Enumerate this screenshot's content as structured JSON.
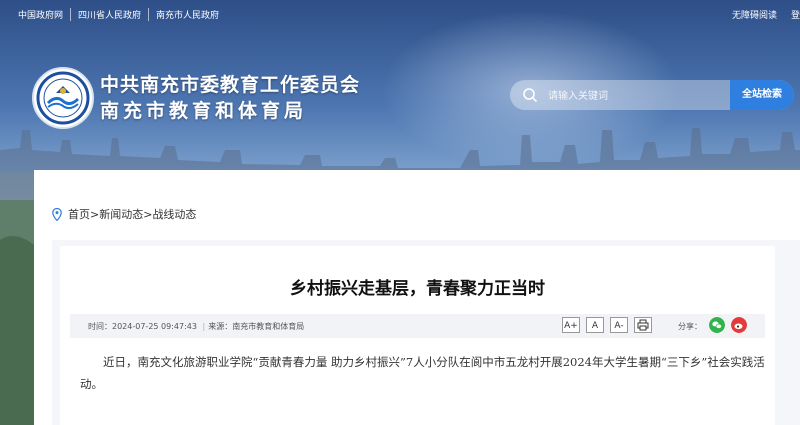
{
  "topbar": {
    "links": [
      "中国政府网",
      "四川省人民政府",
      "南充市人民政府"
    ],
    "accessibility": "无障碍阅读",
    "login": "登"
  },
  "header": {
    "title_line1": "中共南充市委教育工作委员会",
    "title_line2": "南充市教育和体育局"
  },
  "search": {
    "placeholder": "请输入关键词",
    "button_label": "全站检索"
  },
  "breadcrumb": {
    "home": "首页",
    "sep1": ">",
    "section": "新闻动态",
    "sep2": ">",
    "current": "战线动态"
  },
  "article": {
    "title": "乡村振兴走基层，青春聚力正当时",
    "time_label": "时间：",
    "time": "2024-07-25 09:47:43",
    "source_label": "来源：",
    "source": "南充市教育和体育局",
    "tools": [
      "A+",
      "A",
      "A-"
    ],
    "share_label": "分享：",
    "paragraph": "近日，南充文化旅游职业学院“贡献青春力量 助力乡村振兴”7人小分队在阆中市五龙村开展2024年大学生暑期“三下乡”社会实践活动。"
  },
  "colors": {
    "accent_blue": "#2f7fe0",
    "wechat_green": "#2fb34a",
    "weibo_red": "#e33b3b"
  }
}
